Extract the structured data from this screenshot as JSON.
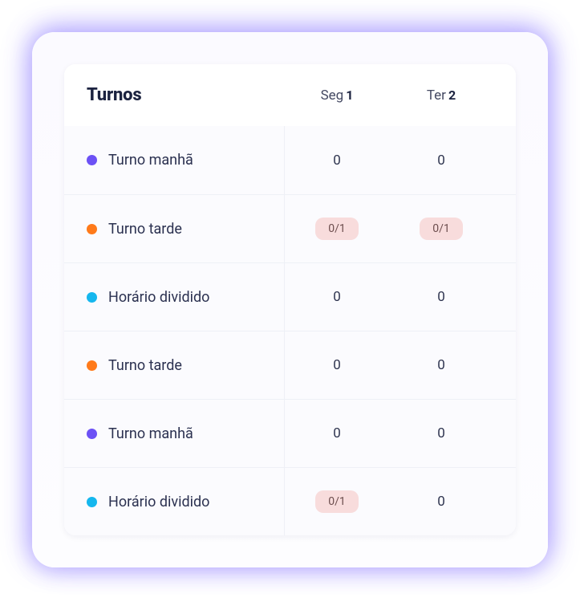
{
  "colors": {
    "purple": "#6c51f5",
    "orange": "#ff7a1a",
    "cyan": "#15b7ee"
  },
  "header": {
    "title": "Turnos",
    "days": [
      {
        "label": "Seg",
        "num": "1"
      },
      {
        "label": "Ter",
        "num": "2"
      }
    ]
  },
  "rows": [
    {
      "name": "Turno manhã",
      "color": "purple",
      "cells": [
        {
          "text": "0",
          "badge": false
        },
        {
          "text": "0",
          "badge": false
        }
      ]
    },
    {
      "name": "Turno tarde",
      "color": "orange",
      "cells": [
        {
          "text": "0/1",
          "badge": true
        },
        {
          "text": "0/1",
          "badge": true
        }
      ]
    },
    {
      "name": "Horário dividido",
      "color": "cyan",
      "cells": [
        {
          "text": "0",
          "badge": false
        },
        {
          "text": "0",
          "badge": false
        }
      ]
    },
    {
      "name": "Turno tarde",
      "color": "orange",
      "cells": [
        {
          "text": "0",
          "badge": false
        },
        {
          "text": "0",
          "badge": false
        }
      ]
    },
    {
      "name": "Turno manhã",
      "color": "purple",
      "cells": [
        {
          "text": "0",
          "badge": false
        },
        {
          "text": "0",
          "badge": false
        }
      ]
    },
    {
      "name": "Horário dividido",
      "color": "cyan",
      "cells": [
        {
          "text": "0/1",
          "badge": true
        },
        {
          "text": "0",
          "badge": false
        }
      ]
    }
  ]
}
